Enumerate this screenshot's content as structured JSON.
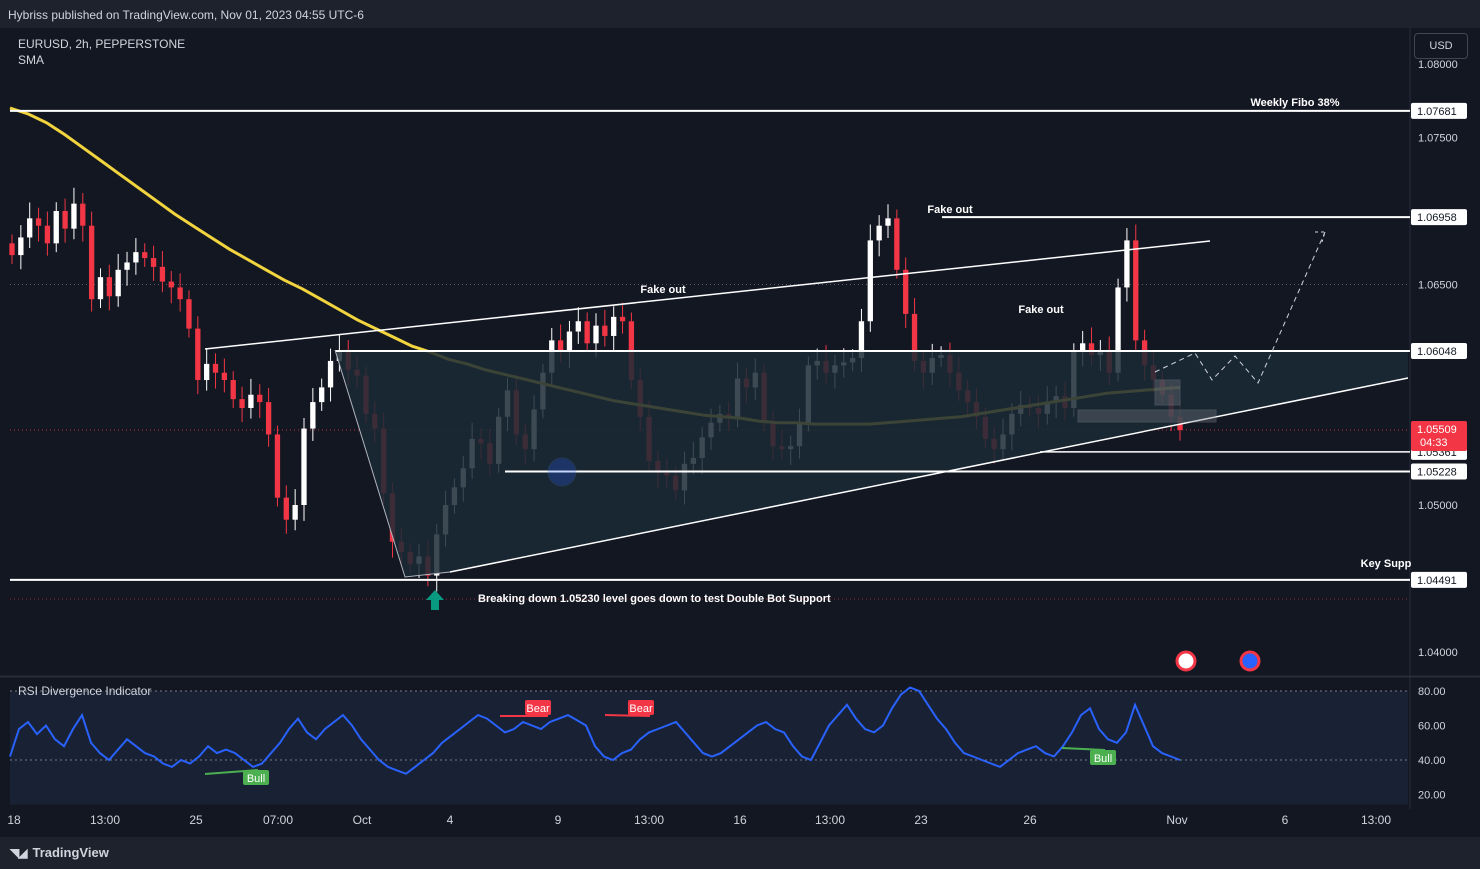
{
  "header": {
    "publisher": "Hybriss published on TradingView.com, Nov 01, 2023 04:55 UTC-6"
  },
  "symbol": {
    "line1": "EURUSD, 2h, PEPPERSTONE",
    "line2": "SMA"
  },
  "currency_button": "USD",
  "rsi_title": "RSI Divergence Indicator",
  "footer": {
    "brand": "TradingView"
  },
  "colors": {
    "bull": "#ffffff",
    "bear": "#f23645",
    "sma": "#f2d43e",
    "rsi": "#2962ff",
    "level_tag_bg": "#ffffff",
    "price_tag_bg": "#f23645"
  },
  "chart_data": [
    {
      "type": "candlestick",
      "title": "",
      "ylim": [
        1.038,
        1.081
      ],
      "y_ticks": [
        "1.08000",
        "1.07500",
        "1.06500",
        "1.05000",
        "1.04000"
      ],
      "x_ticks": [
        "18",
        "13:00",
        "25",
        "07:00",
        "Oct",
        "4",
        "9",
        "13:00",
        "16",
        "13:00",
        "23",
        "26",
        "Nov",
        "6",
        "13:00"
      ],
      "close": [
        1.067,
        1.0682,
        1.0695,
        1.069,
        1.0678,
        1.07,
        1.0688,
        1.0705,
        1.069,
        1.064,
        1.0655,
        1.0642,
        1.066,
        1.0665,
        1.0672,
        1.0668,
        1.0662,
        1.0652,
        1.0648,
        1.064,
        1.062,
        1.0585,
        1.0596,
        1.059,
        1.0585,
        1.0572,
        1.0566,
        1.0575,
        1.057,
        1.0548,
        1.0505,
        1.049,
        1.05,
        1.0552,
        1.057,
        1.058,
        1.0598,
        1.0605,
        1.0592,
        1.0588,
        1.0562,
        1.0552,
        1.0508,
        1.0475,
        1.0468,
        1.046,
        1.0465,
        1.0452,
        1.048,
        1.05,
        1.0512,
        1.0525,
        1.0545,
        1.0542,
        1.0528,
        1.056,
        1.0578,
        1.0548,
        1.0538,
        1.0565,
        1.059,
        1.0612,
        1.0604,
        1.0618,
        1.0625,
        1.061,
        1.0622,
        1.0615,
        1.0628,
        1.0625,
        1.0585,
        1.056,
        1.053,
        1.0522,
        1.052,
        1.051,
        1.0528,
        1.0532,
        1.0546,
        1.0556,
        1.0562,
        1.056,
        1.0586,
        1.058,
        1.059,
        1.0556,
        1.054,
        1.0538,
        1.054,
        1.0556,
        1.0595,
        1.0598,
        1.059,
        1.0595,
        1.0597,
        1.06,
        1.0625,
        1.068,
        1.069,
        1.0695,
        1.066,
        1.063,
        1.0598,
        1.059,
        1.06,
        1.0602,
        1.059,
        1.0578,
        1.057,
        1.056,
        1.0545,
        1.0538,
        1.0548,
        1.0562,
        1.0568,
        1.0566,
        1.0562,
        1.057,
        1.0574,
        1.0566,
        1.0604,
        1.061,
        1.0602,
        1.0605,
        1.059,
        1.0648,
        1.068,
        1.0612,
        1.0595,
        1.0585,
        1.0575,
        1.056,
        1.0551
      ],
      "sma": [
        1.077,
        1.0766,
        1.076,
        1.0752,
        1.0743,
        1.0734,
        1.0725,
        1.0716,
        1.0707,
        1.0698,
        1.069,
        1.0682,
        1.0674,
        1.0667,
        1.066,
        1.0653,
        1.0647,
        1.064,
        1.0633,
        1.0626,
        1.062,
        1.0614,
        1.0608,
        1.0604,
        1.0599,
        1.0596,
        1.0592,
        1.0589,
        1.0586,
        1.0583,
        1.058,
        1.0577,
        1.0574,
        1.0571,
        1.0569,
        1.0567,
        1.0565,
        1.0563,
        1.0561,
        1.056,
        1.0559,
        1.0557,
        1.0556,
        1.0556,
        1.0555,
        1.0555,
        1.0555,
        1.0555,
        1.0556,
        1.0557,
        1.0558,
        1.0559,
        1.056,
        1.0562,
        1.0564,
        1.0566,
        1.0568,
        1.057,
        1.0572,
        1.0574,
        1.0576,
        1.0577,
        1.0578,
        1.0579,
        1.058
      ],
      "annotations": [
        "Weekly Fibo  38%",
        "Fake out",
        "Fake out",
        "Fake out",
        "Key Supp",
        "Breaking down 1.05230 level goes down to test Double Bot Support"
      ],
      "levels": [
        {
          "label": "1.07681",
          "value": 1.07681
        },
        {
          "label": "1.06958",
          "value": 1.06958
        },
        {
          "label": "1.06048",
          "value": 1.06048
        },
        {
          "label": "1.05361",
          "value": 1.05361
        },
        {
          "label": "1.05228",
          "value": 1.05228
        },
        {
          "label": "1.04491",
          "value": 1.04491
        }
      ],
      "last_price": {
        "value": "1.05509",
        "countdown": "04:33"
      }
    },
    {
      "type": "line",
      "title": "RSI Divergence Indicator",
      "ylim": [
        15,
        85
      ],
      "y_ticks": [
        "80.00",
        "60.00",
        "40.00",
        "20.00"
      ],
      "values": [
        42,
        58,
        62,
        55,
        60,
        52,
        48,
        58,
        66,
        50,
        44,
        40,
        46,
        52,
        48,
        44,
        42,
        38,
        36,
        40,
        38,
        42,
        48,
        44,
        46,
        44,
        40,
        36,
        38,
        44,
        50,
        58,
        64,
        56,
        52,
        58,
        62,
        66,
        60,
        52,
        46,
        40,
        36,
        34,
        32,
        36,
        40,
        44,
        50,
        54,
        58,
        62,
        66,
        64,
        60,
        56,
        58,
        62,
        60,
        58,
        62,
        64,
        66,
        63,
        60,
        48,
        42,
        40,
        44,
        46,
        52,
        56,
        58,
        60,
        62,
        56,
        50,
        44,
        42,
        44,
        48,
        52,
        56,
        60,
        62,
        58,
        56,
        48,
        42,
        40,
        50,
        60,
        66,
        72,
        64,
        58,
        56,
        60,
        70,
        78,
        82,
        80,
        72,
        64,
        58,
        50,
        44,
        42,
        40,
        38,
        36,
        40,
        44,
        46,
        48,
        44,
        42,
        48,
        56,
        66,
        70,
        58,
        52,
        50,
        56,
        72,
        60,
        48,
        44,
        42,
        40
      ],
      "badges": [
        {
          "text": "Bull",
          "kind": "bull"
        },
        {
          "text": "Bear",
          "kind": "bear"
        },
        {
          "text": "Bear",
          "kind": "bear"
        },
        {
          "text": "Bull",
          "kind": "bull"
        }
      ]
    }
  ]
}
